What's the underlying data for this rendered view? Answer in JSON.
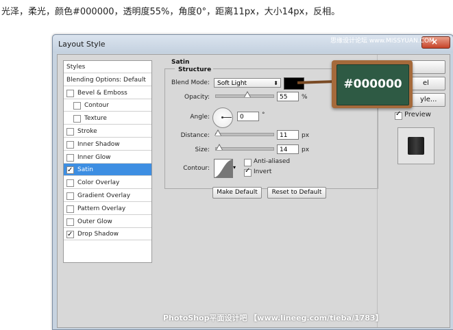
{
  "caption": "光泽，柔光，颜色#000000，透明度55%，角度0°，距离11px，大小14px，反相。",
  "watermark_top": "思缘设计论坛 www.MISSYUAN.COM",
  "window": {
    "title": "Layout Style"
  },
  "styles_list": [
    {
      "label": "Styles",
      "type": "header"
    },
    {
      "label": "Blending Options: Default",
      "type": "header"
    },
    {
      "label": "Bevel & Emboss",
      "checked": false
    },
    {
      "label": "Contour",
      "checked": false,
      "indent": true
    },
    {
      "label": "Texture",
      "checked": false,
      "indent": true
    },
    {
      "label": "Stroke",
      "checked": false
    },
    {
      "label": "Inner Shadow",
      "checked": false
    },
    {
      "label": "Inner Glow",
      "checked": false
    },
    {
      "label": "Satin",
      "checked": true,
      "selected": true
    },
    {
      "label": "Color Overlay",
      "checked": false
    },
    {
      "label": "Gradient Overlay",
      "checked": false
    },
    {
      "label": "Pattern Overlay",
      "checked": false
    },
    {
      "label": "Outer Glow",
      "checked": false
    },
    {
      "label": "Drop Shadow",
      "checked": true
    }
  ],
  "satin": {
    "section_title": "Satin",
    "structure_title": "Structure",
    "blend_mode_label": "Blend Mode:",
    "blend_mode_value": "Soft Light",
    "color": "#000000",
    "opacity_label": "Opacity:",
    "opacity_value": "55",
    "opacity_unit": "%",
    "opacity_level": 0.55,
    "angle_label": "Angle:",
    "angle_value": "0",
    "angle_unit": "°",
    "distance_label": "Distance:",
    "distance_value": "11",
    "distance_unit": "px",
    "distance_level": 0.04,
    "size_label": "Size:",
    "size_value": "14",
    "size_unit": "px",
    "size_level": 0.06,
    "contour_label": "Contour:",
    "anti_aliased_label": "Anti-aliased",
    "anti_aliased_checked": false,
    "invert_label": "Invert",
    "invert_checked": true,
    "make_default_label": "Make Default",
    "reset_default_label": "Reset to Default"
  },
  "right": {
    "cancel_label": "el",
    "new_style_label": "yle...",
    "preview_label": "Preview",
    "preview_checked": true
  },
  "callout": {
    "text": "#000000"
  },
  "watermark_bottom": "PhotoShop平面设计吧  【www.lineeg.com/tieba/1783】"
}
